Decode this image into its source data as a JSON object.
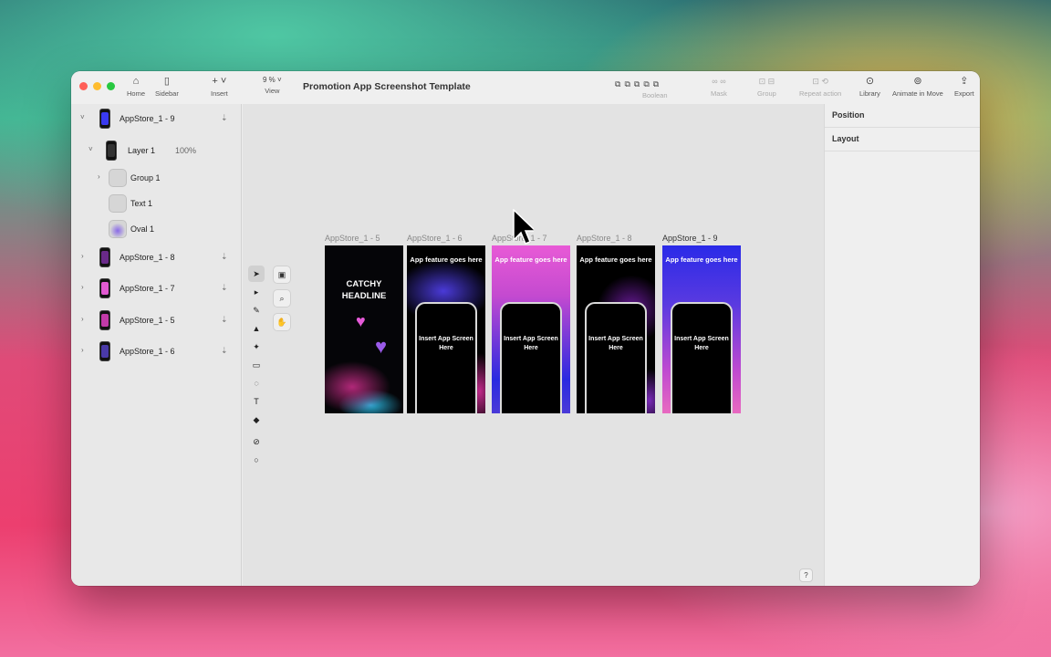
{
  "window": {
    "title": "Promotion App Screenshot Template",
    "zoom": "9 %"
  },
  "toolbar": {
    "home": "Home",
    "sidebar": "Sidebar",
    "insert": "Insert",
    "view": "View",
    "boolean": "Boolean",
    "mask": "Mask",
    "group": "Group",
    "repeat_action": "Repeat action",
    "library": "Library",
    "animate": "Animate in Move",
    "export": "Export"
  },
  "layers": [
    {
      "name": "AppStore_1 - 9",
      "level": 0,
      "expanded": true,
      "kind": "artboard",
      "color": "#3a3af0"
    },
    {
      "name": "Layer 1",
      "level": 1,
      "expanded": true,
      "kind": "layer",
      "opacity": "100%"
    },
    {
      "name": "Group 1",
      "level": 2,
      "expanded": false,
      "kind": "group"
    },
    {
      "name": "Text 1",
      "level": 2,
      "kind": "text"
    },
    {
      "name": "Oval 1",
      "level": 2,
      "kind": "oval"
    },
    {
      "name": "AppStore_1 - 8",
      "level": 0,
      "expanded": false,
      "kind": "artboard",
      "color": "#6a2a8a"
    },
    {
      "name": "AppStore_1 - 7",
      "level": 0,
      "expanded": false,
      "kind": "artboard",
      "color": "#e25ad2"
    },
    {
      "name": "AppStore_1 - 5",
      "level": 0,
      "expanded": false,
      "kind": "artboard",
      "color": "#c23aa8"
    },
    {
      "name": "AppStore_1 - 6",
      "level": 0,
      "expanded": false,
      "kind": "artboard",
      "color": "#4a3aa8"
    }
  ],
  "artboards": [
    {
      "label": "AppStore_1 - 5",
      "headline": "CATCHY HEADLINE",
      "selected": false
    },
    {
      "label": "AppStore_1 - 6",
      "feature": "App feature goes here",
      "screen": "Insert App Screen Here",
      "selected": false
    },
    {
      "label": "AppStore_1 - 7",
      "feature": "App feature goes here",
      "screen": "Insert App Screen Here",
      "selected": false
    },
    {
      "label": "AppStore_1 - 8",
      "feature": "App feature goes here",
      "screen": "Insert App Screen Here",
      "selected": false
    },
    {
      "label": "AppStore_1 - 9",
      "feature": "App feature goes here",
      "screen": "Insert App Screen Here",
      "selected": true
    }
  ],
  "inspector": {
    "position": "Position",
    "layout": "Layout"
  },
  "help": "?",
  "colors": {
    "close": "#ff5f57",
    "minimize": "#febc2e",
    "zoom": "#28c840"
  }
}
